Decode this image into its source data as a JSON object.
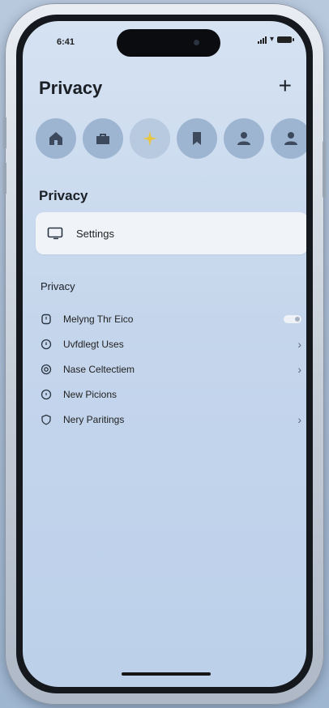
{
  "status": {
    "time": "6:41"
  },
  "header": {
    "title": "Privacy",
    "add_label": "+"
  },
  "avatars": [
    {
      "icon": "home-icon"
    },
    {
      "icon": "briefcase-icon"
    },
    {
      "icon": "sparkle-icon",
      "selected": true
    },
    {
      "icon": "bookmark-icon"
    },
    {
      "icon": "person-icon"
    },
    {
      "icon": "person-icon"
    }
  ],
  "section": {
    "title": "Privacy"
  },
  "settings_card": {
    "label": "Settings",
    "icon": "tablet-icon"
  },
  "list": {
    "title": "Privacy",
    "items": [
      {
        "label": "Melyng Thr Eico",
        "icon": "clock-icon",
        "trailing": "toggle"
      },
      {
        "label": "Uvfdlegt Uses",
        "icon": "info-circle-icon",
        "trailing": "chevron"
      },
      {
        "label": "Nase Celtectiem",
        "icon": "at-icon",
        "trailing": "chevron"
      },
      {
        "label": "New Picions",
        "icon": "circle-icon",
        "trailing": "none"
      },
      {
        "label": "Nery Paritings",
        "icon": "shield-icon",
        "trailing": "chevron"
      }
    ]
  },
  "colors": {
    "screen_bg": "#c5d6ec",
    "avatar_bg": "#9eb5d2",
    "card_bg": "#f0f4f9"
  }
}
